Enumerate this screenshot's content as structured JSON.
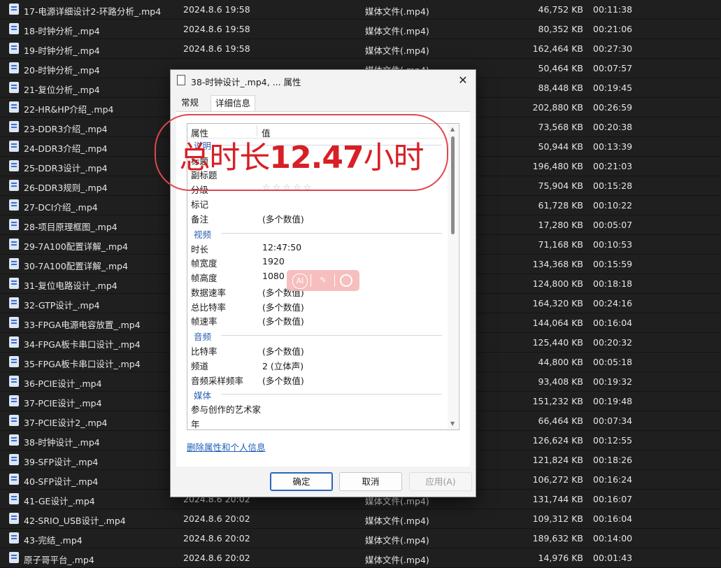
{
  "files": [
    {
      "name": "17-电源详细设计2-环路分析_.mp4",
      "date": "2024.8.6 19:58",
      "type": "媒体文件(.mp4)",
      "size": "46,752 KB",
      "duration": "00:11:38"
    },
    {
      "name": "18-时钟分析_.mp4",
      "date": "2024.8.6 19:58",
      "type": "媒体文件(.mp4)",
      "size": "80,352 KB",
      "duration": "00:21:06"
    },
    {
      "name": "19-时钟分析_.mp4",
      "date": "2024.8.6 19:58",
      "type": "媒体文件(.mp4)",
      "size": "162,464 KB",
      "duration": "00:27:30"
    },
    {
      "name": "20-时钟分析_.mp4",
      "date": "",
      "type": "媒体文件(.mp4)",
      "size": "50,464 KB",
      "duration": "00:07:57"
    },
    {
      "name": "21-复位分析_.mp4",
      "date": "",
      "type": "",
      "size": "88,448 KB",
      "duration": "00:19:45"
    },
    {
      "name": "22-HR&HP介绍_.mp4",
      "date": "",
      "type": "",
      "size": "202,880 KB",
      "duration": "00:26:59"
    },
    {
      "name": "23-DDR3介绍_.mp4",
      "date": "",
      "type": "",
      "size": "73,568 KB",
      "duration": "00:20:38"
    },
    {
      "name": "24-DDR3介绍_.mp4",
      "date": "",
      "type": "",
      "size": "50,944 KB",
      "duration": "00:13:39"
    },
    {
      "name": "25-DDR3设计_.mp4",
      "date": "",
      "type": "",
      "size": "196,480 KB",
      "duration": "00:21:03"
    },
    {
      "name": "26-DDR3规则_.mp4",
      "date": "",
      "type": "",
      "size": "75,904 KB",
      "duration": "00:15:28"
    },
    {
      "name": "27-DCI介绍_.mp4",
      "date": "",
      "type": "",
      "size": "61,728 KB",
      "duration": "00:10:22"
    },
    {
      "name": "28-项目原理框图_.mp4",
      "date": "",
      "type": "",
      "size": "17,280 KB",
      "duration": "00:05:07"
    },
    {
      "name": "29-7A100配置详解_.mp4",
      "date": "",
      "type": "",
      "size": "71,168 KB",
      "duration": "00:10:53"
    },
    {
      "name": "30-7A100配置详解_.mp4",
      "date": "",
      "type": "",
      "size": "134,368 KB",
      "duration": "00:15:59"
    },
    {
      "name": "31-复位电路设计_.mp4",
      "date": "",
      "type": "",
      "size": "124,800 KB",
      "duration": "00:18:18"
    },
    {
      "name": "32-GTP设计_.mp4",
      "date": "",
      "type": "",
      "size": "164,320 KB",
      "duration": "00:24:16"
    },
    {
      "name": "33-FPGA电源电容放置_.mp4",
      "date": "",
      "type": "",
      "size": "144,064 KB",
      "duration": "00:16:04"
    },
    {
      "name": "34-FPGA板卡串口设计_.mp4",
      "date": "",
      "type": "",
      "size": "125,440 KB",
      "duration": "00:20:32"
    },
    {
      "name": "35-FPGA板卡串口设计_.mp4",
      "date": "",
      "type": "",
      "size": "44,800 KB",
      "duration": "00:05:18"
    },
    {
      "name": "36-PCIE设计_.mp4",
      "date": "",
      "type": "",
      "size": "93,408 KB",
      "duration": "00:19:32"
    },
    {
      "name": "37-PCIE设计_.mp4",
      "date": "",
      "type": "",
      "size": "151,232 KB",
      "duration": "00:19:48"
    },
    {
      "name": "37-PCIE设计2_.mp4",
      "date": "",
      "type": "",
      "size": "66,464 KB",
      "duration": "00:07:34"
    },
    {
      "name": "38-时钟设计_.mp4",
      "date": "",
      "type": "",
      "size": "126,624 KB",
      "duration": "00:12:55"
    },
    {
      "name": "39-SFP设计_.mp4",
      "date": "",
      "type": "",
      "size": "121,824 KB",
      "duration": "00:18:26"
    },
    {
      "name": "40-SFP设计_.mp4",
      "date": "",
      "type": "",
      "size": "106,272 KB",
      "duration": "00:16:24"
    },
    {
      "name": "41-GE设计_.mp4",
      "date": "2024.8.6 20:02",
      "type": "媒体文件(.mp4)",
      "size": "131,744 KB",
      "duration": "00:16:07"
    },
    {
      "name": "42-SRIO_USB设计_.mp4",
      "date": "2024.8.6 20:02",
      "type": "媒体文件(.mp4)",
      "size": "109,312 KB",
      "duration": "00:16:04"
    },
    {
      "name": "43-完结_.mp4",
      "date": "2024.8.6 20:02",
      "type": "媒体文件(.mp4)",
      "size": "189,632 KB",
      "duration": "00:14:00"
    },
    {
      "name": "原子哥平台_.mp4",
      "date": "2024.8.6 20:02",
      "type": "媒体文件(.mp4)",
      "size": "14,976 KB",
      "duration": "00:01:43"
    }
  ],
  "dialog": {
    "title": "38-时钟设计_.mp4, ... 属性",
    "close_glyph": "✕",
    "tabs": {
      "general": "常规",
      "details": "详细信息"
    },
    "header": {
      "property": "属性",
      "value": "值"
    },
    "groups": {
      "description": "说明",
      "video": "视频",
      "audio": "音频",
      "media": "媒体"
    },
    "rows": {
      "title_label": "标题",
      "subtitle_label": "副标题",
      "rating_label": "分级",
      "rating_stars": "☆☆☆☆☆",
      "tags_label": "标记",
      "comments_label": "备注",
      "comments_value": "(多个数值)",
      "length_label": "时长",
      "length_value": "12:47:50",
      "frame_width_label": "帧宽度",
      "frame_width_value": "1920",
      "frame_height_label": "帧高度",
      "frame_height_value": "1080",
      "data_rate_label": "数据速率",
      "data_rate_value": "(多个数值)",
      "total_bitrate_label": "总比特率",
      "total_bitrate_value": "(多个数值)",
      "frame_rate_label": "帧速率",
      "frame_rate_value": "(多个数值)",
      "bitrate_label": "比特率",
      "bitrate_value": "(多个数值)",
      "channels_label": "频道",
      "channels_value": "2 (立体声)",
      "sample_rate_label": "音频采样频率",
      "sample_rate_value": "(多个数值)",
      "contributing_artists_label": "参与创作的艺术家",
      "year_label": "年"
    },
    "remove_link": "删除属性和个人信息",
    "buttons": {
      "ok": "确定",
      "cancel": "取消",
      "apply": "应用(A)"
    }
  },
  "annotation": {
    "prefix": "总时长",
    "number": "12.47",
    "suffix": "小时"
  },
  "ai_toolbar": {
    "ai_label": "AI",
    "wand_glyph": "✎",
    "search_glyph": ""
  },
  "colors": {
    "annotation_red": "#d72026",
    "link_blue": "#1f5fb8",
    "group_blue": "#2b5fb3"
  }
}
